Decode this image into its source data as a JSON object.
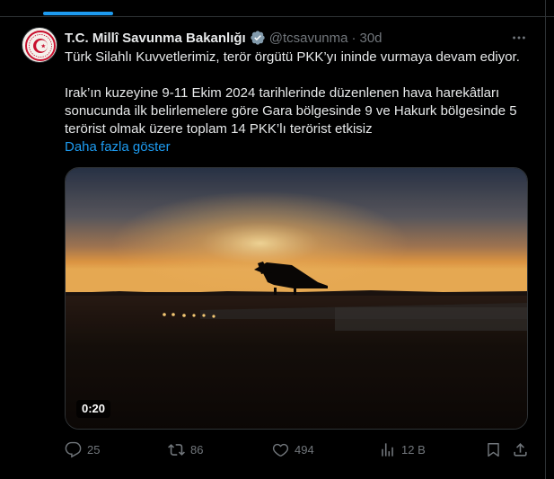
{
  "author": {
    "display_name": "T.C. Millî Savunma Bakanlığı",
    "handle": "@tcsavunma",
    "separator": "·",
    "timestamp": "30d",
    "verified_badge_color": "#829aab"
  },
  "tweet": {
    "line1": "Türk Silahlı Kuvvetlerimiz, terör örgütü PKK’yı ininde vurmaya devam ediyor.",
    "line2": "Irak’ın kuzeyine 9-11 Ekim 2024 tarihlerinde düzenlenen hava harekâtları sonucunda ilk belirlemelere göre Gara bölgesinde 9 ve Hakurk bölgesinde 5 terörist olmak üzere toplam 14 PKK’lı terörist etkisiz",
    "show_more": "Daha fazla göster"
  },
  "media": {
    "type": "video",
    "duration": "0:20"
  },
  "actions": {
    "replies": "25",
    "reposts": "86",
    "likes": "494",
    "views": "12 B"
  },
  "colors": {
    "accent": "#1d9bf0",
    "muted": "#71767b",
    "text": "#e7e9ea",
    "border": "#2f3336",
    "background": "#000000"
  }
}
